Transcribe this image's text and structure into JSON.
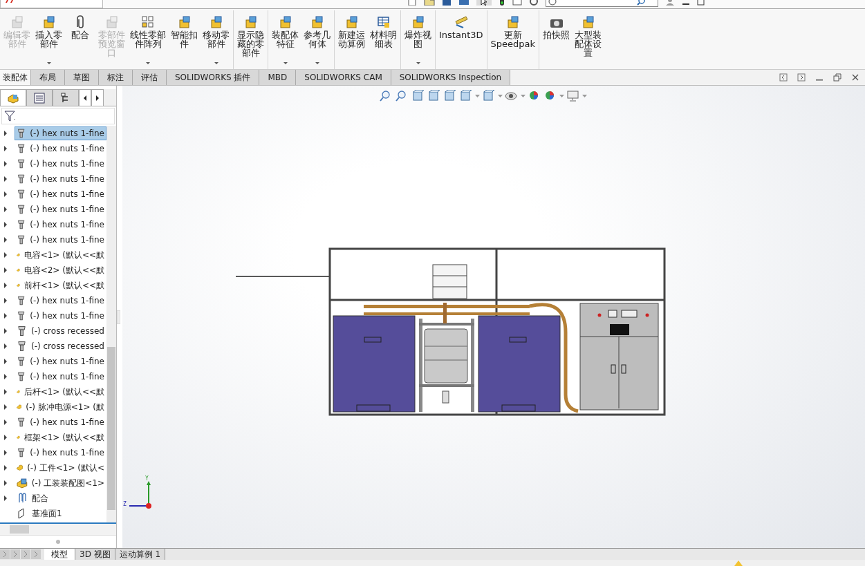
{
  "ribbon": [
    {
      "buttons": [
        {
          "lines": [
            "编辑零",
            "部件"
          ],
          "disabled": true,
          "dropdown": false
        },
        {
          "lines": [
            "插入零",
            "部件"
          ],
          "disabled": false,
          "dropdown": true
        },
        {
          "lines": [
            "配合"
          ],
          "disabled": false,
          "dropdown": false
        },
        {
          "lines": [
            "零部件",
            "预览窗",
            "口"
          ],
          "disabled": true,
          "dropdown": false
        },
        {
          "lines": [
            "线性零部",
            "件阵列"
          ],
          "disabled": false,
          "dropdown": true
        },
        {
          "lines": [
            "智能扣",
            "件"
          ],
          "disabled": false,
          "dropdown": false
        },
        {
          "lines": [
            "移动零",
            "部件"
          ],
          "disabled": false,
          "dropdown": true
        }
      ]
    },
    {
      "buttons": [
        {
          "lines": [
            "显示隐",
            "藏的零",
            "部件"
          ],
          "disabled": false,
          "dropdown": false
        }
      ]
    },
    {
      "buttons": [
        {
          "lines": [
            "装配体",
            "特征"
          ],
          "disabled": false,
          "dropdown": true
        },
        {
          "lines": [
            "参考几",
            "何体"
          ],
          "disabled": false,
          "dropdown": true
        }
      ]
    },
    {
      "buttons": [
        {
          "lines": [
            "新建运",
            "动算例"
          ],
          "disabled": false,
          "dropdown": false
        },
        {
          "lines": [
            "材料明",
            "细表"
          ],
          "disabled": false,
          "dropdown": false
        }
      ]
    },
    {
      "buttons": [
        {
          "lines": [
            "爆炸视",
            "图"
          ],
          "disabled": false,
          "dropdown": true
        }
      ]
    },
    {
      "buttons": [
        {
          "lines": [
            "Instant3D"
          ],
          "disabled": false,
          "dropdown": false
        }
      ]
    },
    {
      "buttons": [
        {
          "lines": [
            "更新",
            "Speedpak"
          ],
          "disabled": false,
          "dropdown": false
        }
      ]
    },
    {
      "buttons": [
        {
          "lines": [
            "拍快照"
          ],
          "disabled": false,
          "dropdown": false
        },
        {
          "lines": [
            "大型装",
            "配体设",
            "置"
          ],
          "disabled": false,
          "dropdown": false
        }
      ]
    }
  ],
  "tabs": [
    {
      "label": "装配体",
      "selected": true
    },
    {
      "label": "布局",
      "selected": false
    },
    {
      "label": "草图",
      "selected": false
    },
    {
      "label": "标注",
      "selected": false
    },
    {
      "label": "评估",
      "selected": false
    },
    {
      "label": "SOLIDWORKS 插件",
      "selected": false
    },
    {
      "label": "MBD",
      "selected": false
    },
    {
      "label": "SOLIDWORKS CAM",
      "selected": false
    },
    {
      "label": "SOLIDWORKS Inspection",
      "selected": false
    }
  ],
  "tree": [
    {
      "kind": "fastener",
      "label": "(-) hex nuts 1-fine",
      "selected": true
    },
    {
      "kind": "fastener",
      "label": "(-) hex nuts 1-fine",
      "selected": false
    },
    {
      "kind": "fastener",
      "label": "(-) hex nuts 1-fine",
      "selected": false
    },
    {
      "kind": "fastener",
      "label": "(-) hex nuts 1-fine",
      "selected": false
    },
    {
      "kind": "fastener",
      "label": "(-) hex nuts 1-fine",
      "selected": false
    },
    {
      "kind": "fastener",
      "label": "(-) hex nuts 1-fine",
      "selected": false
    },
    {
      "kind": "fastener",
      "label": "(-) hex nuts 1-fine",
      "selected": false
    },
    {
      "kind": "fastener",
      "label": "(-) hex nuts 1-fine",
      "selected": false
    },
    {
      "kind": "part",
      "label": "电容<1> (默认<<默",
      "selected": false
    },
    {
      "kind": "part",
      "label": "电容<2> (默认<<默",
      "selected": false
    },
    {
      "kind": "part",
      "label": "前杆<1> (默认<<默",
      "selected": false
    },
    {
      "kind": "fastener",
      "label": "(-) hex nuts 1-fine",
      "selected": false
    },
    {
      "kind": "fastener",
      "label": "(-) hex nuts 1-fine",
      "selected": false
    },
    {
      "kind": "fastener",
      "label": "(-) cross recessed",
      "selected": false
    },
    {
      "kind": "fastener",
      "label": "(-) cross recessed",
      "selected": false
    },
    {
      "kind": "fastener",
      "label": "(-) hex nuts 1-fine",
      "selected": false
    },
    {
      "kind": "fastener",
      "label": "(-) hex nuts 1-fine",
      "selected": false
    },
    {
      "kind": "part",
      "label": "后杆<1> (默认<<默",
      "selected": false
    },
    {
      "kind": "part",
      "label": "(-) 脉冲电源<1> (默",
      "selected": false
    },
    {
      "kind": "fastener",
      "label": "(-) hex nuts 1-fine",
      "selected": false
    },
    {
      "kind": "part",
      "label": "框架<1> (默认<<默",
      "selected": false
    },
    {
      "kind": "fastener",
      "label": "(-) hex nuts 1-fine",
      "selected": false
    },
    {
      "kind": "part",
      "label": "(-) 工件<1> (默认<",
      "selected": false
    },
    {
      "kind": "assembly",
      "label": "(-) 工装装配图<1>",
      "selected": false
    },
    {
      "kind": "mates",
      "label": "配合",
      "selected": false
    },
    {
      "kind": "plane",
      "label": "基准面1",
      "selected": false
    }
  ],
  "triad": {
    "y": "Y",
    "z": "Z"
  },
  "bottom_tabs": [
    {
      "label": "模型",
      "selected": true
    },
    {
      "label": "3D 视图",
      "selected": false
    },
    {
      "label": "运动算例 1",
      "selected": false
    }
  ]
}
